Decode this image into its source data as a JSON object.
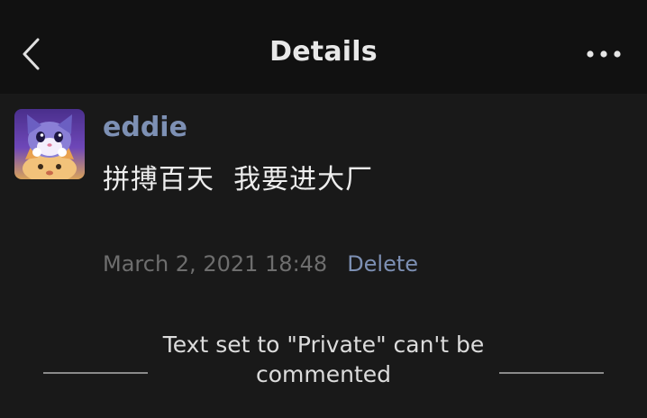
{
  "navbar": {
    "title": "Details",
    "back_icon": "chevron-left-icon",
    "more_icon": "ellipsis-icon"
  },
  "post": {
    "username": "eddie",
    "text": "拼搏百天  我要进大厂",
    "timestamp": "March 2, 2021 18:48",
    "delete_label": "Delete"
  },
  "notice": {
    "text": "Text set to \"Private\" can't be commented"
  },
  "colors": {
    "background": "#191919",
    "navbar": "#111111",
    "link": "#7d90b4",
    "muted": "#6e6e6e",
    "text": "#ededed"
  }
}
